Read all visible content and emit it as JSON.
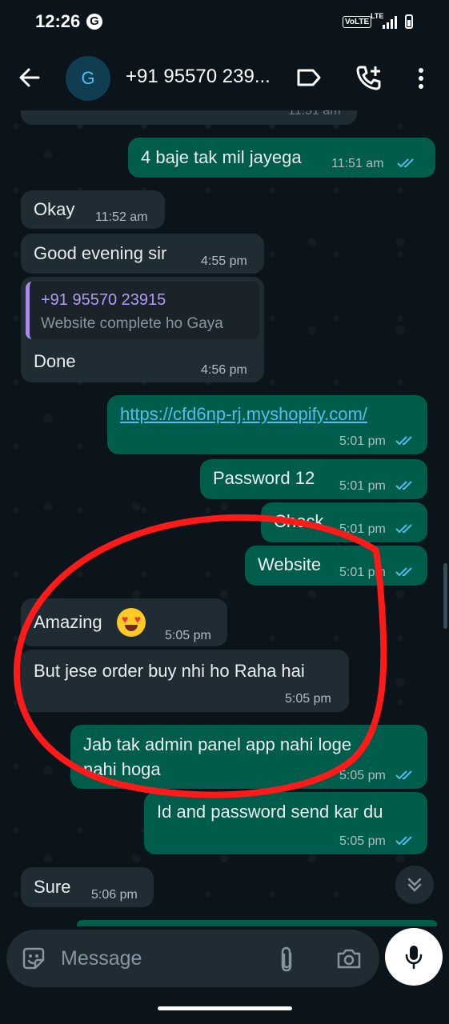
{
  "status_bar": {
    "time": "12:26",
    "g_badge": "G",
    "volte": "VoLTE",
    "lte": "LTE"
  },
  "header": {
    "avatar_letter": "G",
    "contact_name": "+91 95570 239..."
  },
  "messages": [
    {
      "id": "m0",
      "dir": "in",
      "text": "",
      "time": "11:51 am"
    },
    {
      "id": "m1",
      "dir": "out",
      "text": "4 baje tak mil jayega",
      "time": "11:51 am"
    },
    {
      "id": "m2",
      "dir": "in",
      "text": "Okay",
      "time": "11:52 am"
    },
    {
      "id": "m3",
      "dir": "in",
      "text": "Good evening sir",
      "time": "4:55 pm"
    },
    {
      "id": "m4",
      "dir": "in",
      "quote_name": "+91 95570 23915",
      "quote_text": "Website complete ho Gaya",
      "text": "Done",
      "time": "4:56 pm"
    },
    {
      "id": "m5",
      "dir": "out",
      "text": "https://cfd6np-rj.myshopify.com/",
      "time": "5:01 pm"
    },
    {
      "id": "m6",
      "dir": "out",
      "text": "Password 12",
      "time": "5:01 pm"
    },
    {
      "id": "m7",
      "dir": "out",
      "text": "Check",
      "time": "5:01 pm"
    },
    {
      "id": "m8",
      "dir": "out",
      "text": "Website",
      "time": "5:01 pm"
    },
    {
      "id": "m9",
      "dir": "in",
      "text": "Amazing",
      "time": "5:05 pm"
    },
    {
      "id": "m10",
      "dir": "in",
      "text": "But jese order buy nhi ho Raha hai",
      "time": "5:05 pm"
    },
    {
      "id": "m11",
      "dir": "out",
      "text_line1": "Jab tak admin panel app nahi loge",
      "text_line2": "nahi hoga",
      "time": "5:05 pm"
    },
    {
      "id": "m12",
      "dir": "out",
      "text": "Id and password send kar du",
      "time": "5:05 pm"
    },
    {
      "id": "m13",
      "dir": "in",
      "text": "Sure",
      "time": "5:06 pm"
    }
  ],
  "input": {
    "placeholder": "Message"
  },
  "colors": {
    "incoming": "#202c33",
    "outgoing": "#005c4b",
    "read_ticks": "#53bdeb",
    "annotation": "#ff0000"
  }
}
